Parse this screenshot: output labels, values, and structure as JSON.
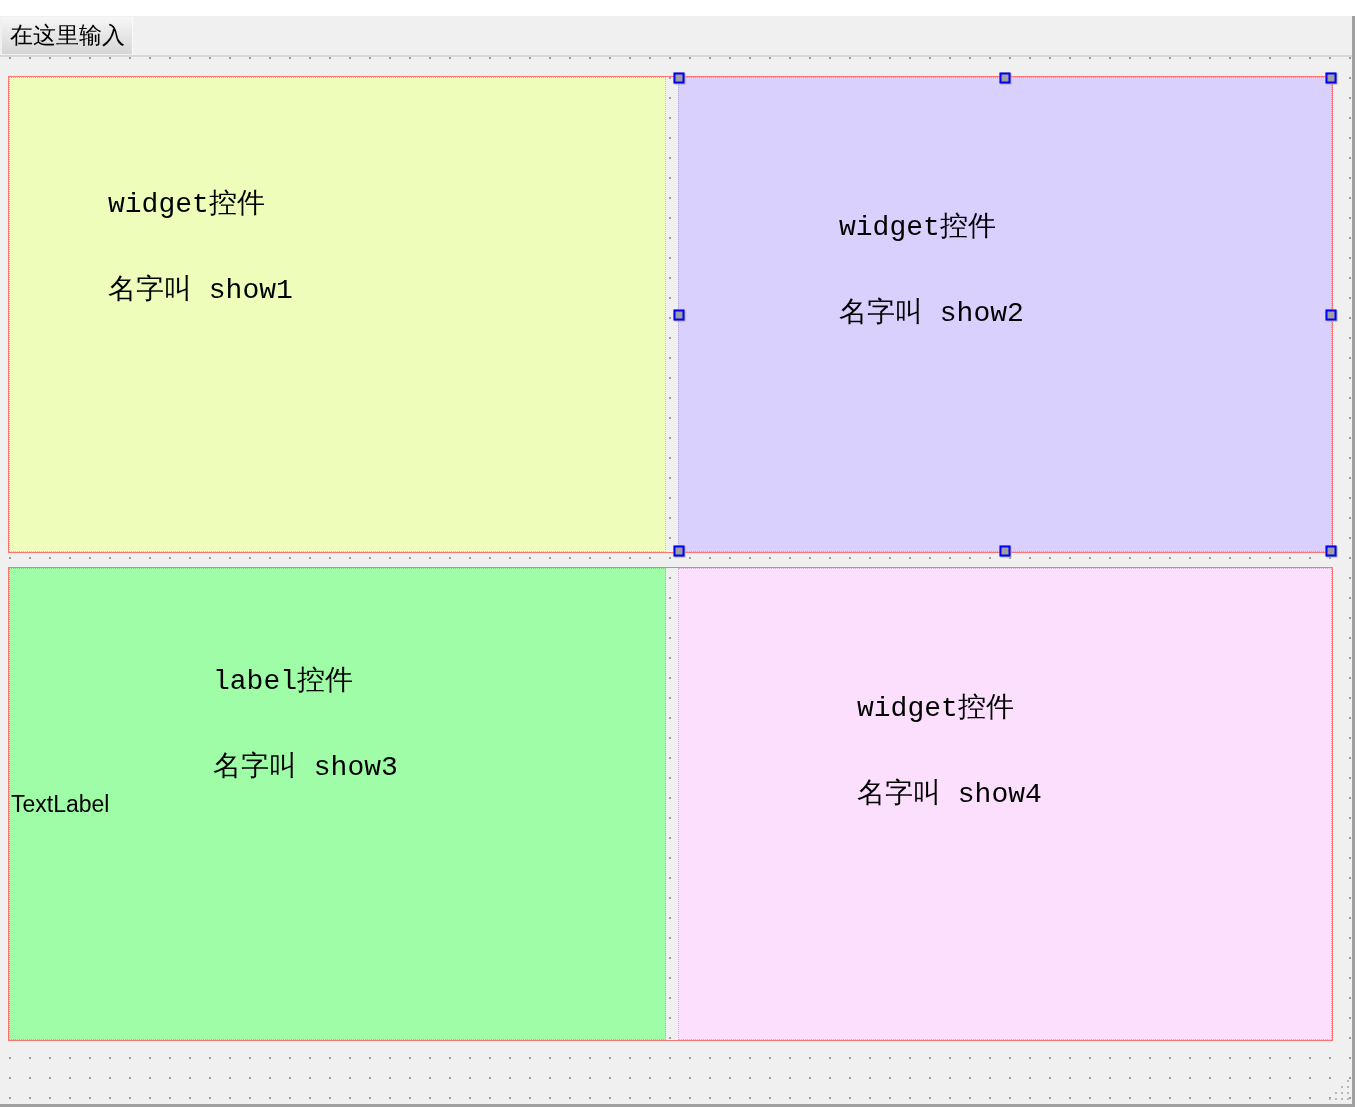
{
  "menu_bar": {
    "items": [
      {
        "label": "在这里输入"
      }
    ]
  },
  "rows": [
    {
      "panels": [
        {
          "color": "#effdbb",
          "selected": false,
          "lines": [
            "widget控件",
            "名字叫 show1"
          ]
        },
        {
          "color": "#dad0fe",
          "selected": true,
          "lines": [
            "widget控件",
            "名字叫 show2"
          ]
        }
      ]
    },
    {
      "panels": [
        {
          "color": "#9ffda8",
          "selected": false,
          "lines": [
            "label控件",
            "名字叫 show3"
          ],
          "label_text": "TextLabel"
        },
        {
          "color": "#fbdffc",
          "selected": false,
          "lines": [
            "widget控件",
            "名字叫 show4"
          ]
        }
      ]
    }
  ]
}
